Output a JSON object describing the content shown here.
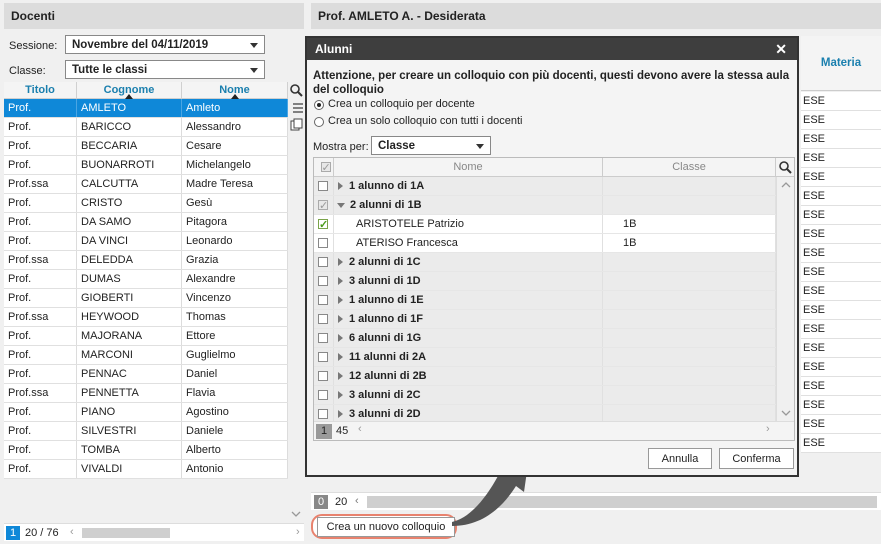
{
  "left_panel": {
    "title": "Docenti",
    "session_label": "Sessione:",
    "session_value": "Novembre del 04/11/2019",
    "class_label": "Classe:",
    "class_value": "Tutte le classi",
    "columns": [
      "Titolo",
      "Cognome",
      "Nome"
    ],
    "rows": [
      [
        "Prof.",
        "AMLETO",
        "Amleto"
      ],
      [
        "Prof.",
        "BARICCO",
        "Alessandro"
      ],
      [
        "Prof.",
        "BECCARIA",
        "Cesare"
      ],
      [
        "Prof.",
        "BUONARROTI",
        "Michelangelo"
      ],
      [
        "Prof.ssa",
        "CALCUTTA",
        "Madre Teresa"
      ],
      [
        "Prof.",
        "CRISTO",
        "Gesù"
      ],
      [
        "Prof.",
        "DA SAMO",
        "Pitagora"
      ],
      [
        "Prof.",
        "DA VINCI",
        "Leonardo"
      ],
      [
        "Prof.ssa",
        "DELEDDA",
        "Grazia"
      ],
      [
        "Prof.",
        "DUMAS",
        "Alexandre"
      ],
      [
        "Prof.",
        "GIOBERTI",
        "Vincenzo"
      ],
      [
        "Prof.ssa",
        "HEYWOOD",
        "Thomas"
      ],
      [
        "Prof.",
        "MAJORANA",
        "Ettore"
      ],
      [
        "Prof.",
        "MARCONI",
        "Guglielmo"
      ],
      [
        "Prof.",
        "PENNAC",
        "Daniel"
      ],
      [
        "Prof.ssa",
        "PENNETTA",
        "Flavia"
      ],
      [
        "Prof.",
        "PIANO",
        "Agostino"
      ],
      [
        "Prof.",
        "SILVESTRI",
        "Daniele"
      ],
      [
        "Prof.",
        "TOMBA",
        "Alberto"
      ],
      [
        "Prof.",
        "VIVALDI",
        "Antonio"
      ]
    ],
    "pager_page": "1",
    "pager_count": "20 / 76"
  },
  "right_panel": {
    "title": "Prof. AMLETO A. - Desiderata",
    "column_materia": "Materia",
    "materia_values": [
      "ESE",
      "ESE",
      "ESE",
      "ESE",
      "ESE",
      "ESE",
      "ESE",
      "ESE",
      "ESE",
      "ESE",
      "ESE",
      "ESE",
      "ESE",
      "ESE",
      "ESE",
      "ESE",
      "ESE",
      "ESE",
      "ESE"
    ],
    "pager_page": "0",
    "pager_count": "20",
    "new_button": "Crea un nuovo colloquio"
  },
  "modal": {
    "title": "Alunni",
    "close": "✕",
    "warning": "Attenzione, per creare un colloquio con più docenti, questi devono avere la stessa aula del colloquio",
    "option1": "Crea un colloquio per docente",
    "option2": "Crea un solo colloquio con tutti i docenti",
    "show_by_label": "Mostra per:",
    "show_by_value": "Classe",
    "col_nome": "Nome",
    "col_classe": "Classe",
    "rows": [
      {
        "label": "1 alunno di 1A",
        "classe": "",
        "kind": "group"
      },
      {
        "label": "2 alunni di 1B",
        "classe": "",
        "kind": "group-open"
      },
      {
        "label": "ARISTOTELE Patrizio",
        "classe": "1B",
        "kind": "student-checked"
      },
      {
        "label": "ATERISO Francesca",
        "classe": "1B",
        "kind": "student"
      },
      {
        "label": "2 alunni di 1C",
        "classe": "",
        "kind": "group"
      },
      {
        "label": "3 alunni di 1D",
        "classe": "",
        "kind": "group"
      },
      {
        "label": "1 alunno di 1E",
        "classe": "",
        "kind": "group"
      },
      {
        "label": "1 alunno di 1F",
        "classe": "",
        "kind": "group"
      },
      {
        "label": "6 alunni di 1G",
        "classe": "",
        "kind": "group"
      },
      {
        "label": "11 alunni di 2A",
        "classe": "",
        "kind": "group"
      },
      {
        "label": "12 alunni di 2B",
        "classe": "",
        "kind": "group"
      },
      {
        "label": "3 alunni di 2C",
        "classe": "",
        "kind": "group"
      },
      {
        "label": "3 alunni di 2D",
        "classe": "",
        "kind": "group"
      }
    ],
    "footer_selected": "1",
    "footer_total": "45",
    "cancel": "Annulla",
    "confirm": "Conferma"
  },
  "colors": {
    "selection": "#0f88d8",
    "header_link": "#1a7fae",
    "highlight": "#e8826e",
    "modal_title_bar": "#3e3e3e"
  }
}
